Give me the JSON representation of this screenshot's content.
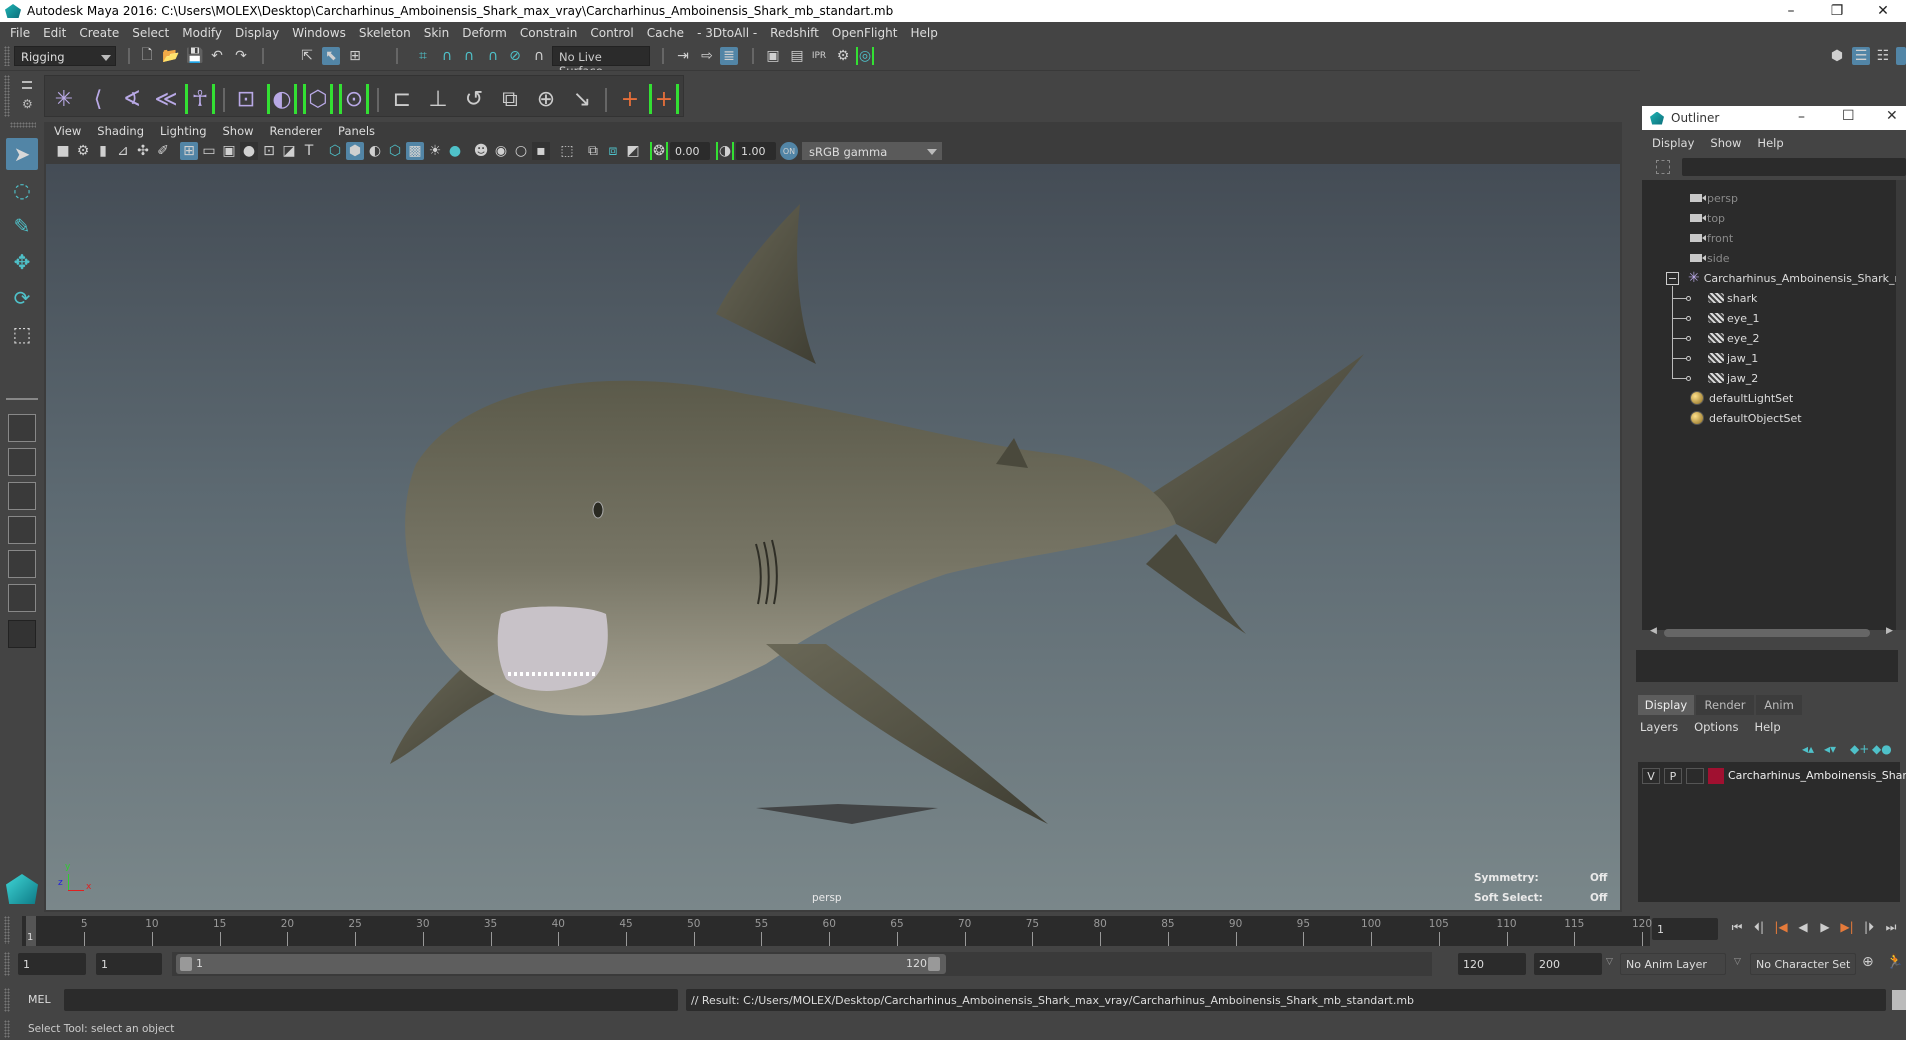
{
  "window": {
    "title": "Autodesk Maya 2016: C:\\Users\\MOLEX\\Desktop\\Carcharhinus_Amboinensis_Shark_max_vray\\Carcharhinus_Amboinensis_Shark_mb_standart.mb",
    "minimize": "–",
    "restore": "❐",
    "close": "✕"
  },
  "menubar": [
    "File",
    "Edit",
    "Create",
    "Select",
    "Modify",
    "Display",
    "Windows",
    "Skeleton",
    "Skin",
    "Deform",
    "Constrain",
    "Control",
    "Cache",
    "- 3DtoAll -",
    "Redshift",
    "OpenFlight",
    "Help"
  ],
  "statusline": {
    "menuset": "Rigging",
    "live_surface": "No Live Surface"
  },
  "panel": {
    "menu": [
      "View",
      "Shading",
      "Lighting",
      "Show",
      "Renderer",
      "Panels"
    ],
    "exposure": "0.00",
    "gamma": "1.00",
    "color_space": "sRGB gamma",
    "camera_label": "persp",
    "hud": [
      {
        "label": "Symmetry:",
        "value": "Off"
      },
      {
        "label": "Soft Select:",
        "value": "Off"
      }
    ],
    "axis": {
      "x": "x",
      "y": "y",
      "z": "z"
    }
  },
  "outliner": {
    "title": "Outliner",
    "menu": [
      "Display",
      "Show",
      "Help"
    ],
    "items": [
      {
        "label": "persp",
        "type": "camera",
        "dim": true
      },
      {
        "label": "top",
        "type": "camera",
        "dim": true
      },
      {
        "label": "front",
        "type": "camera",
        "dim": true
      },
      {
        "label": "side",
        "type": "camera",
        "dim": true
      },
      {
        "label": "Carcharhinus_Amboinensis_Shark_nc",
        "type": "group",
        "expanded": true
      },
      {
        "label": "shark",
        "type": "mesh",
        "child": true
      },
      {
        "label": "eye_1",
        "type": "mesh",
        "child": true
      },
      {
        "label": "eye_2",
        "type": "mesh",
        "child": true
      },
      {
        "label": "jaw_1",
        "type": "mesh",
        "child": true
      },
      {
        "label": "jaw_2",
        "type": "mesh",
        "child": true
      },
      {
        "label": "defaultLightSet",
        "type": "set"
      },
      {
        "label": "defaultObjectSet",
        "type": "set"
      }
    ]
  },
  "layers": {
    "tabs": [
      "Display",
      "Render",
      "Anim"
    ],
    "active_tab": "Display",
    "menu": [
      "Layers",
      "Options",
      "Help"
    ],
    "rows": [
      {
        "v": "V",
        "p": "P",
        "color": "#a01030",
        "name": "Carcharhinus_Amboinensis_Shar"
      }
    ]
  },
  "timeline": {
    "ticks": [
      "5",
      "10",
      "15",
      "20",
      "25",
      "30",
      "35",
      "40",
      "45",
      "50",
      "55",
      "60",
      "65",
      "70",
      "75",
      "80",
      "85",
      "90",
      "95",
      "100",
      "105",
      "110",
      "115",
      "120"
    ],
    "start": 1,
    "end": 120,
    "current_marker": "1",
    "current_frame": "1"
  },
  "range": {
    "start_time": "1",
    "playback_start": "1",
    "slider_start": "1",
    "slider_end": "120",
    "playback_end": "120",
    "end_time": "200",
    "anim_layer": "No Anim Layer",
    "character_set": "No Character Set"
  },
  "command": {
    "mode": "MEL",
    "input": "",
    "result": "// Result: C:/Users/MOLEX/Desktop/Carcharhinus_Amboinensis_Shark_max_vray/Carcharhinus_Amboinensis_Shark_mb_standart.mb"
  },
  "helpline": "Select Tool: select an object"
}
